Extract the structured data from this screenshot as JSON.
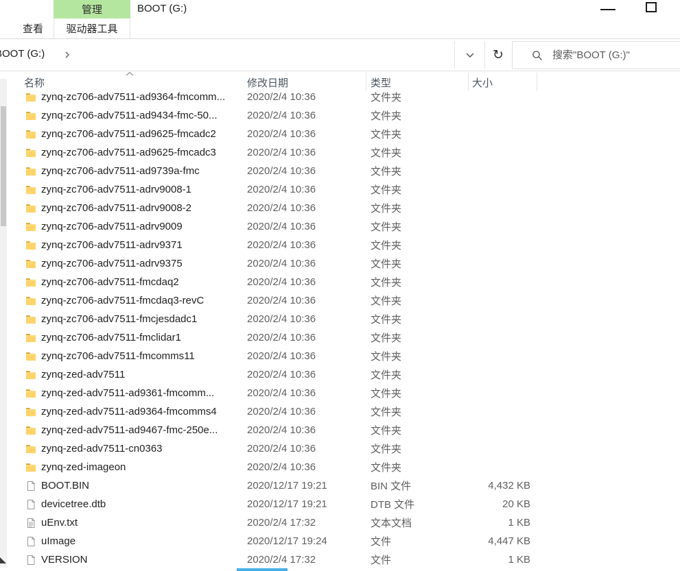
{
  "window": {
    "contextual_tab": "管理",
    "title": "BOOT (G:)",
    "tab_view": "查看",
    "tab_drive_tools": "驱动器工具"
  },
  "address_bar": {
    "breadcrumb": "BOOT (G:)",
    "search_placeholder": "搜索\"BOOT (G:)\""
  },
  "columns": {
    "name": "名称",
    "modified": "修改日期",
    "type": "类型",
    "size": "大小"
  },
  "colors": {
    "contextual_tab_green": "#b5e6a0",
    "folder_yellow": "#fed46a",
    "header_text": "#4a5560",
    "secondary_text": "#5f5f5f",
    "bottom_accent_blue": "#45b0e8"
  },
  "rows": [
    {
      "name": "zynq-zc706-adv7511-ad9364-fmcomm...",
      "modified": "2020/2/4 10:36",
      "type": "文件夹",
      "size": "",
      "icon": "folder"
    },
    {
      "name": "zynq-zc706-adv7511-ad9434-fmc-50...",
      "modified": "2020/2/4 10:36",
      "type": "文件夹",
      "size": "",
      "icon": "folder"
    },
    {
      "name": "zynq-zc706-adv7511-ad9625-fmcadc2",
      "modified": "2020/2/4 10:36",
      "type": "文件夹",
      "size": "",
      "icon": "folder"
    },
    {
      "name": "zynq-zc706-adv7511-ad9625-fmcadc3",
      "modified": "2020/2/4 10:36",
      "type": "文件夹",
      "size": "",
      "icon": "folder"
    },
    {
      "name": "zynq-zc706-adv7511-ad9739a-fmc",
      "modified": "2020/2/4 10:36",
      "type": "文件夹",
      "size": "",
      "icon": "folder"
    },
    {
      "name": "zynq-zc706-adv7511-adrv9008-1",
      "modified": "2020/2/4 10:36",
      "type": "文件夹",
      "size": "",
      "icon": "folder"
    },
    {
      "name": "zynq-zc706-adv7511-adrv9008-2",
      "modified": "2020/2/4 10:36",
      "type": "文件夹",
      "size": "",
      "icon": "folder"
    },
    {
      "name": "zynq-zc706-adv7511-adrv9009",
      "modified": "2020/2/4 10:36",
      "type": "文件夹",
      "size": "",
      "icon": "folder"
    },
    {
      "name": "zynq-zc706-adv7511-adrv9371",
      "modified": "2020/2/4 10:36",
      "type": "文件夹",
      "size": "",
      "icon": "folder"
    },
    {
      "name": "zynq-zc706-adv7511-adrv9375",
      "modified": "2020/2/4 10:36",
      "type": "文件夹",
      "size": "",
      "icon": "folder"
    },
    {
      "name": "zynq-zc706-adv7511-fmcdaq2",
      "modified": "2020/2/4 10:36",
      "type": "文件夹",
      "size": "",
      "icon": "folder"
    },
    {
      "name": "zynq-zc706-adv7511-fmcdaq3-revC",
      "modified": "2020/2/4 10:36",
      "type": "文件夹",
      "size": "",
      "icon": "folder"
    },
    {
      "name": "zynq-zc706-adv7511-fmcjesdadc1",
      "modified": "2020/2/4 10:36",
      "type": "文件夹",
      "size": "",
      "icon": "folder"
    },
    {
      "name": "zynq-zc706-adv7511-fmclidar1",
      "modified": "2020/2/4 10:36",
      "type": "文件夹",
      "size": "",
      "icon": "folder"
    },
    {
      "name": "zynq-zc706-adv7511-fmcomms11",
      "modified": "2020/2/4 10:36",
      "type": "文件夹",
      "size": "",
      "icon": "folder"
    },
    {
      "name": "zynq-zed-adv7511",
      "modified": "2020/2/4 10:36",
      "type": "文件夹",
      "size": "",
      "icon": "folder"
    },
    {
      "name": "zynq-zed-adv7511-ad9361-fmcomm...",
      "modified": "2020/2/4 10:36",
      "type": "文件夹",
      "size": "",
      "icon": "folder"
    },
    {
      "name": "zynq-zed-adv7511-ad9364-fmcomms4",
      "modified": "2020/2/4 10:36",
      "type": "文件夹",
      "size": "",
      "icon": "folder"
    },
    {
      "name": "zynq-zed-adv7511-ad9467-fmc-250e...",
      "modified": "2020/2/4 10:36",
      "type": "文件夹",
      "size": "",
      "icon": "folder"
    },
    {
      "name": "zynq-zed-adv7511-cn0363",
      "modified": "2020/2/4 10:36",
      "type": "文件夹",
      "size": "",
      "icon": "folder"
    },
    {
      "name": "zynq-zed-imageon",
      "modified": "2020/2/4 10:36",
      "type": "文件夹",
      "size": "",
      "icon": "folder"
    },
    {
      "name": "BOOT.BIN",
      "modified": "2020/12/17 19:21",
      "type": "BIN 文件",
      "size": "4,432 KB",
      "icon": "file"
    },
    {
      "name": "devicetree.dtb",
      "modified": "2020/12/17 19:21",
      "type": "DTB 文件",
      "size": "20 KB",
      "icon": "file"
    },
    {
      "name": "uEnv.txt",
      "modified": "2020/2/4 17:32",
      "type": "文本文档",
      "size": "1 KB",
      "icon": "text-file"
    },
    {
      "name": "uImage",
      "modified": "2020/12/17 19:24",
      "type": "文件",
      "size": "4,447 KB",
      "icon": "file"
    },
    {
      "name": "VERSION",
      "modified": "2020/2/4 17:32",
      "type": "文件",
      "size": "1 KB",
      "icon": "file"
    }
  ]
}
